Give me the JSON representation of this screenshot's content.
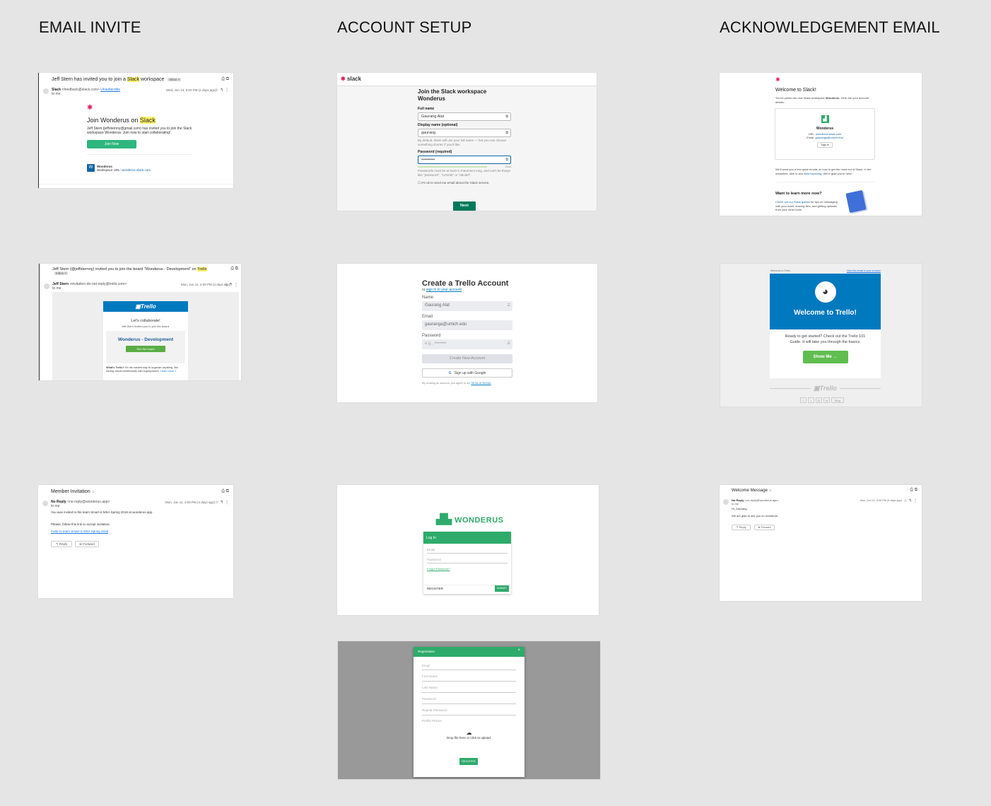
{
  "columns": {
    "email_invite": "EMAIL INVITE",
    "account_setup": "ACCOUNT SETUP",
    "acknowledgement": "ACKNOWLEDGEMENT EMAIL"
  },
  "colors": {
    "slack_green": "#2eb67d",
    "slack_btn": "#007a5a",
    "trello_blue": "#0079bf",
    "trello_green": "#61bd4f",
    "wonderus_green": "#2eab6a"
  },
  "slack_invite": {
    "subject_pre": "Jeff Stern has invited you to join a ",
    "subject_hl": "Slack",
    "subject_post": " workspace",
    "chip": "Inbox ×",
    "from": "Slack",
    "from_email": "<feedback@slack.com>",
    "unsubscribe": "Unsubscribe",
    "to": "to me",
    "date": "Wed, Jun 13, 6:50 PM (2 days ago)",
    "heading_pre": "Join Wonderus on ",
    "heading_hl": "Slack",
    "body": "Jeff Stern (jeffsternny@gmail.com) has invited you to join the Slack workspace Wonderus. Join now to start collaborating!",
    "button": "Join Now",
    "ws_initial": "W",
    "ws_name": "Wonderus",
    "ws_url_label": "Workspace URL: ",
    "ws_url": "wonderus.slack.com"
  },
  "trello_invite": {
    "subject_pre": "Jeff Stern (@jeffsternny) invited you to join the board \"Wonderus - Development\" on ",
    "subject_hl": "Trello",
    "chip": "Inbox ×",
    "from": "Jeff Stern",
    "from_email": "<invitation-do-not-reply@trello.com>",
    "to": "to me",
    "date": "Mon, Jun 11, 4:09 PM (4 days ago)",
    "logo": "Trello",
    "lets": "Let's collaborate!",
    "invited": "Jeff Stern invited you to join the board.",
    "board": "Wonderus - Development",
    "button": "See the board",
    "what_bold": "What's Trello?",
    "what_text": " It's the easiest way to organize anything, like having virtual whiteboards with superpowers. ",
    "learn": "Learn more »"
  },
  "member_invite": {
    "subject": "Member Invitation",
    "from": "No Reply",
    "from_email": "<no-reply@wonderus.app>",
    "to": "to me",
    "date": "Mon, Jun 11, 4:09 PM (4 days ago)",
    "line1": "You was invited to the team Smart is MSA Spring 2018 at wonderus.app",
    "line2": "Please, follow this link to accept invitation:",
    "link": "Invite to team Smart is MSA Spring 2018",
    "reply": "Reply",
    "forward": "Forward"
  },
  "slack_setup": {
    "logo": "slack",
    "title": "Join the Slack workspace Wonderus",
    "full_name_label": "Full name",
    "full_name": "Gaurang Alat",
    "display_label": "Display name (optional)",
    "display": "gaurang",
    "display_help": "By default, Slack will use your full name — but you can choose something shorter if you'd like.",
    "password_label": "Password (required)",
    "password": "••••••••••",
    "strength": "Good",
    "password_help": "Passwords must be at least 6 characters long, and can't be things like \"password\", \"123456\" or \"abcdef\".",
    "checkbox": "It's ok to send me email about the Slack service.",
    "next": "Next"
  },
  "trello_setup": {
    "title": "Create a Trello Account",
    "or": "or ",
    "signin": "sign in to your account",
    "name_label": "Name",
    "name": "Gaurang Alat",
    "email_label": "Email",
    "email": "gauranga@umich.edu",
    "password_label": "Password",
    "password_placeholder": "e.g., ••••••••",
    "create": "Create New Account",
    "google": "Sign up with Google",
    "terms_pre": "By creating an account, you agree to our ",
    "terms": "Terms of Service"
  },
  "wonderus_login": {
    "logo": "WONDERUS",
    "header": "Log In",
    "email": "Email",
    "password": "Password",
    "forgot": "Forgot Password?",
    "register": "REGISTER",
    "submit": "SUBMIT"
  },
  "wonderus_register": {
    "header": "Registration",
    "close": "×",
    "fields": [
      "Email",
      "First Name",
      "Last Name",
      "Password",
      "Repeat Password",
      "Profile Picture"
    ],
    "drop": "Drop file here or click to upload.",
    "button": "REGISTER"
  },
  "slack_ack": {
    "title": "Welcome to Slack!",
    "intro_pre": "You've joined the new Slack workspace ",
    "intro_bold": "Wonderus",
    "intro_post": ". Here are your account details:",
    "ws_name": "Wonderus",
    "url_label": "URL: ",
    "url": "wonderus.slack.com",
    "email_label": "Email: ",
    "email": "gauranga@umich.edu",
    "signin": "Sign in",
    "send_pre": "We'll send you a few quick emails on how to get the most out of Slack. In the meantime, dive in and ",
    "send_link": "start exploring",
    "send_post": ". We're glad you're here!",
    "learn_title": "Want to learn more now?",
    "learn_link": "Check out our Slack guides",
    "learn_text": " for tips on messaging with your team, sharing files, and getting updates from your other tools."
  },
  "trello_ack": {
    "top_left": "Welcome to Trello",
    "top_right": "View this email in your browser",
    "banner": "Welcome to Trello!",
    "body": "Ready to get started? Check out the Trello 101 Guide. It will take you through the basics.",
    "button": "Show Me →",
    "footer_logo": "Trello",
    "socials": [
      "f",
      "t",
      "◎",
      "in",
      "Blog"
    ]
  },
  "welcome_msg": {
    "subject": "Welcome Message",
    "from": "No Reply",
    "from_email": "<no-reply@wonderus.app>",
    "to": "to me",
    "date": "Mon, Jun 11, 4:09 PM (4 days ago)",
    "greeting": "Hi, Gaurang",
    "body": "We are glad to see you on wonderus",
    "reply": "Reply",
    "forward": "Forward"
  }
}
